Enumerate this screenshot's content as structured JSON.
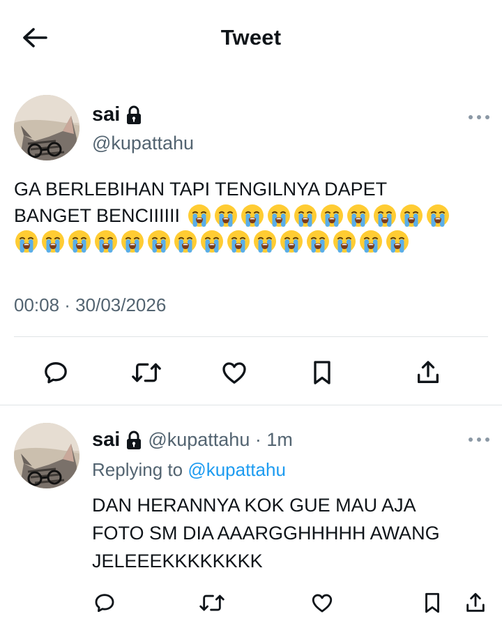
{
  "header": {
    "title": "Tweet",
    "back_icon": "arrow-left-icon"
  },
  "main_tweet": {
    "author_name": "sai",
    "protected_icon": "lock-icon",
    "handle": "@kupattahu",
    "text_line1": "GA BERLEBIHAN TAPI TENGILNYA DAPET",
    "text_line2": "BANGET BENCIIIIII",
    "emoji_name": "loudly-crying-face",
    "emoji_count_line2": 10,
    "emoji_count_line3": 15,
    "timestamp": "00:08 · 30/03/2026",
    "actions": [
      "reply-icon",
      "retweet-icon",
      "like-icon",
      "bookmark-icon",
      "share-icon"
    ]
  },
  "reply_tweet": {
    "author_name": "sai",
    "handle_time": "@kupattahu · 1m",
    "replying_prefix": "Replying to",
    "replying_handle": "@kupattahu",
    "text_line1": "DAN HERANNYA KOK GUE MAU AJA",
    "text_line2": "FOTO SM DIA AAARGGHHHHH AWANG",
    "text_line3": "JELEEEKKKKKKKK",
    "actions": [
      "reply-icon",
      "retweet-icon",
      "like-icon",
      "bookmark-icon",
      "share-icon"
    ]
  },
  "colors": {
    "text": "#0f1419",
    "secondary": "#536471",
    "link": "#1d9bf0",
    "divider": "#dfe3e6"
  }
}
